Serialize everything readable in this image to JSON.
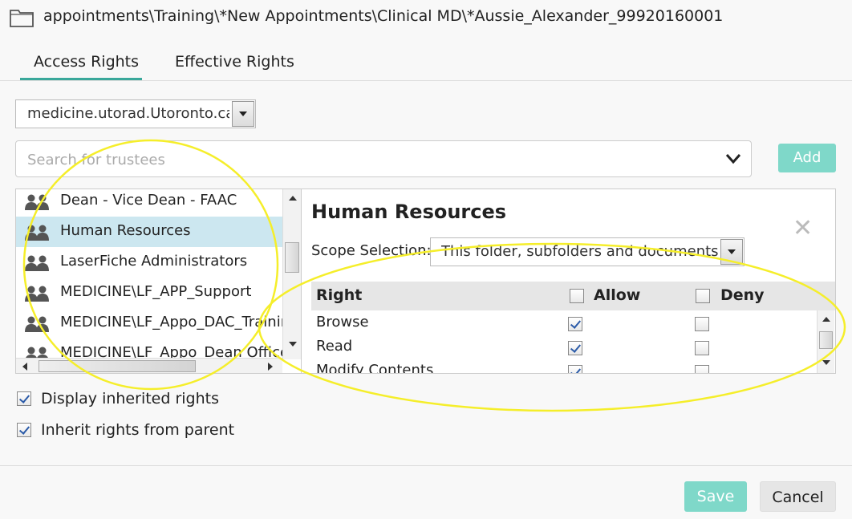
{
  "header": {
    "path": "appointments\\Training\\*New Appointments\\Clinical MD\\*Aussie_Alexander_99920160001"
  },
  "tabs": [
    {
      "label": "Access Rights"
    },
    {
      "label": "Effective Rights"
    }
  ],
  "domain_select": {
    "value": "medicine.utorad.Utoronto.ca"
  },
  "search": {
    "placeholder": "Search for trustees"
  },
  "add_button": {
    "label": "Add"
  },
  "trustees": [
    {
      "label": "Dean - Vice Dean - FAAC"
    },
    {
      "label": "Human Resources"
    },
    {
      "label": "LaserFiche Administrators"
    },
    {
      "label": "MEDICINE\\LF_APP_Support"
    },
    {
      "label": "MEDICINE\\LF_Appo_DAC_Training"
    },
    {
      "label": "MEDICINE\\LF_Appo_Dean Office"
    }
  ],
  "detail": {
    "title": "Human Resources",
    "scope_label": "Scope Selection:",
    "scope_value": "This folder, subfolders and documents",
    "columns": {
      "right": "Right",
      "allow": "Allow",
      "deny": "Deny"
    },
    "rights": [
      {
        "name": "Browse",
        "allow": true,
        "deny": false
      },
      {
        "name": "Read",
        "allow": true,
        "deny": false
      },
      {
        "name": "Modify Contents",
        "allow": true,
        "deny": false
      }
    ]
  },
  "options": {
    "display_inherited": "Display inherited rights",
    "inherit_from_parent": "Inherit rights from parent"
  },
  "footer": {
    "save": "Save",
    "cancel": "Cancel"
  },
  "colors": {
    "accent": "#3aa89b",
    "button_teal": "#7fd8c9",
    "selected_row": "#cce7f0",
    "annotation": "#f5ee2a"
  }
}
